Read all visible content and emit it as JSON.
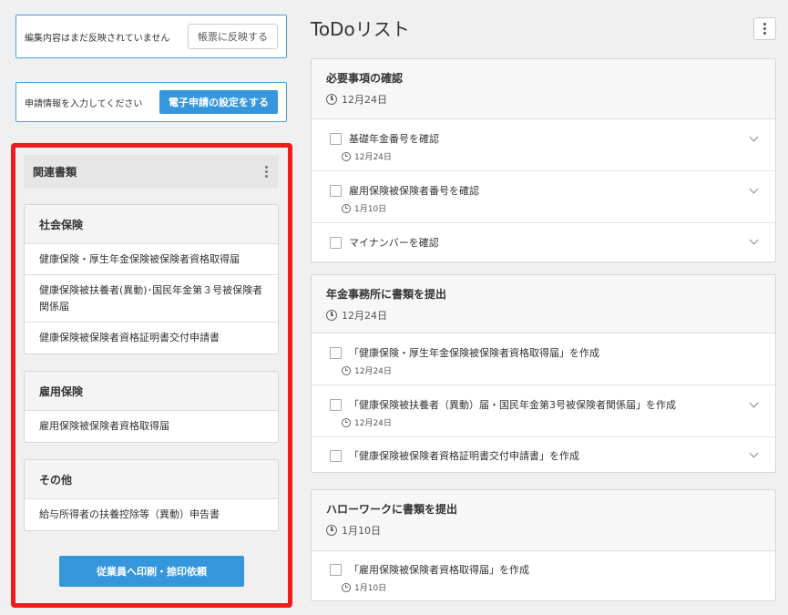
{
  "notices": {
    "unreflected_text": "編集内容はまだ反映されていません",
    "reflect_button": "帳票に反映する",
    "apply_text": "申請情報を入力してください",
    "apply_button": "電子申請の設定をする"
  },
  "related": {
    "title": "関連書類",
    "groups": [
      {
        "title": "社会保険",
        "items": [
          "健康保険・厚生年金保険被保険者資格取得届",
          "健康保険被扶養者(異動)･国民年金第３号被保険者関係届",
          "健康保険被保険者資格証明書交付申請書"
        ]
      },
      {
        "title": "雇用保険",
        "items": [
          "雇用保険被保険者資格取得届"
        ]
      },
      {
        "title": "その他",
        "items": [
          "給与所得者の扶養控除等（異動）申告書"
        ]
      }
    ],
    "print_button": "従業員へ印刷・捺印依頼"
  },
  "todo": {
    "title": "ToDoリスト",
    "cards": [
      {
        "title": "必要事項の確認",
        "date": "12月24日",
        "tasks": [
          {
            "label": "基礎年金番号を確認",
            "date": "12月24日"
          },
          {
            "label": "雇用保険被保険者番号を確認",
            "date": "1月10日"
          },
          {
            "label": "マイナンバーを確認",
            "date": ""
          }
        ]
      },
      {
        "title": "年金事務所に書類を提出",
        "date": "12月24日",
        "tasks": [
          {
            "label": "「健康保険・厚生年金保険被保険者資格取得届」を作成",
            "date": "12月24日"
          },
          {
            "label": "「健康保険被扶養者（異動）届・国民年金第3号被保険者関係届」を作成",
            "date": "12月24日"
          },
          {
            "label": "「健康保険被保険者資格証明書交付申請書」を作成",
            "date": ""
          }
        ]
      },
      {
        "title": "ハローワークに書類を提出",
        "date": "1月10日",
        "tasks": [
          {
            "label": "「雇用保険被保険者資格取得届」を作成",
            "date": "1月10日"
          }
        ]
      }
    ]
  },
  "colors": {
    "accent": "#3596dc",
    "highlight": "#ee1c1c",
    "notice_border": "#4a9fd8"
  }
}
